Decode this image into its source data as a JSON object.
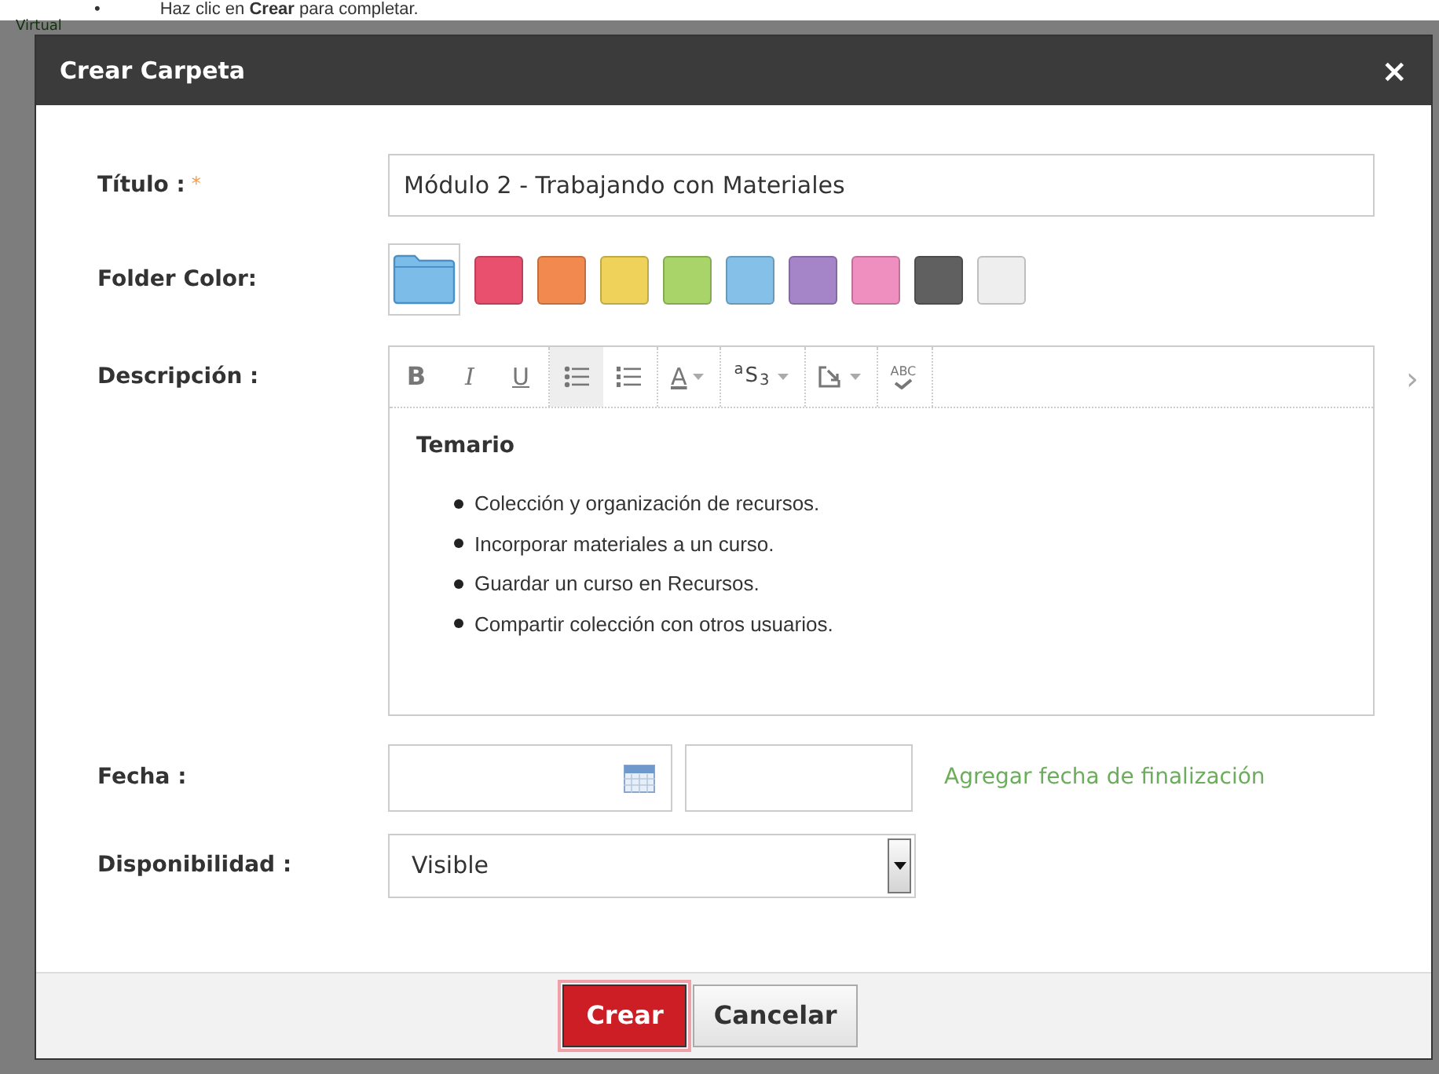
{
  "instruction": {
    "bullet": "•",
    "text": "Haz clic en **Crear** para completar."
  },
  "background": {
    "breadcrumb": "Virtual"
  },
  "dialog": {
    "title": "Crear Carpeta",
    "close": "×",
    "fields": [
      {
        "kind": "text",
        "label": "Título :",
        "required_mark": "*",
        "value": "Módulo 2 - Trabajando con Materiales"
      },
      {
        "kind": "colors",
        "label": "Folder Color:",
        "folder": {
          "color": "#7bbde8"
        },
        "swatches": [
          {
            "color": "#e8506e"
          },
          {
            "color": "#f28a50"
          },
          {
            "color": "#efd25a"
          },
          {
            "color": "#a8d46a"
          },
          {
            "color": "#84c0e8"
          },
          {
            "color": "#a585c8"
          },
          {
            "color": "#ee8fc0"
          },
          {
            "color": "#606060"
          },
          {
            "color": "#eeeeee"
          }
        ]
      },
      {
        "kind": "editor",
        "label": "Descripción :",
        "toolbar": [
          {
            "kind": "bold",
            "label": "B",
            "active": false
          },
          {
            "kind": "italic",
            "label": "I",
            "active": false
          },
          {
            "kind": "underline",
            "label": "U",
            "active": false
          },
          {
            "kind": "bullets",
            "active": true
          },
          {
            "kind": "numbers",
            "active": false
          },
          {
            "kind": "font-color",
            "label": "A",
            "active": false,
            "dropdown": true
          },
          {
            "kind": "script",
            "label": "$^{a}$S$_{3}$",
            "active": false,
            "dropdown": true
          },
          {
            "kind": "insert",
            "active": false,
            "dropdown": true
          },
          {
            "kind": "spell",
            "label": "ABC",
            "active": false
          }
        ],
        "more": "›",
        "heading": "Temario",
        "items": [
          "Colección y organización de recursos.",
          "Incorporar materiales a un curso.",
          "Guardar un curso en Recursos.",
          "Compartir colección con otros usuarios."
        ]
      },
      {
        "kind": "date",
        "label": "Fecha :",
        "link": "Agregar fecha de finalización"
      },
      {
        "kind": "select",
        "label": "Disponibilidad :",
        "value": "Visible"
      }
    ],
    "buttons": [
      {
        "label": "Crear",
        "primary": true
      },
      {
        "label": "Cancelar",
        "primary": false
      }
    ]
  }
}
